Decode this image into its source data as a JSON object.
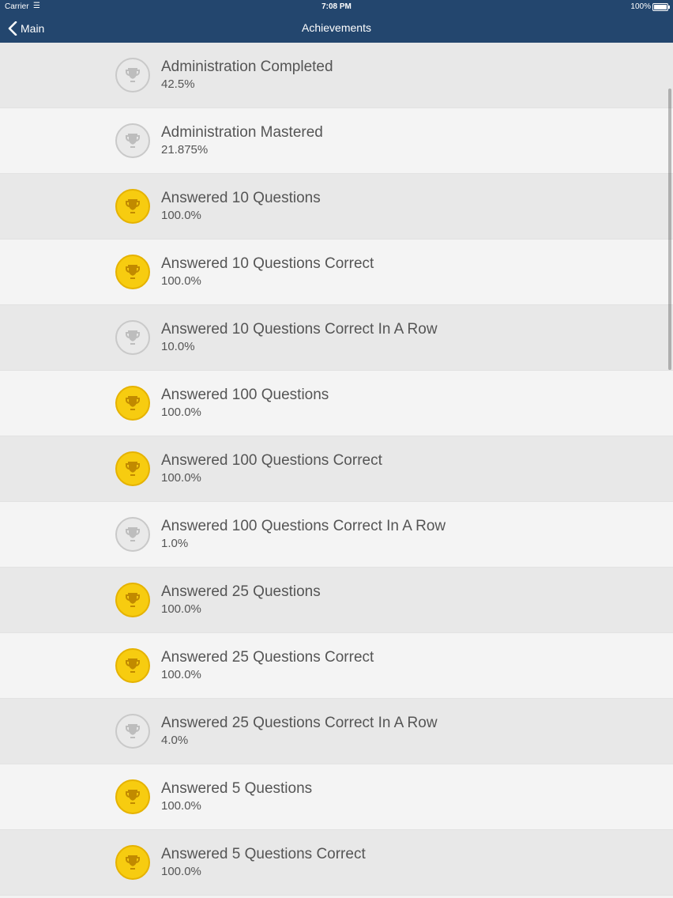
{
  "status_bar": {
    "carrier": "Carrier",
    "time": "7:08 PM",
    "battery": "100%"
  },
  "nav": {
    "back_label": "Main",
    "title": "Achievements"
  },
  "colors": {
    "nav_bar": "#23466e",
    "unlocked": "#f7cc10",
    "locked": "#e9e9e9"
  },
  "achievements": [
    {
      "name": "Administration Completed",
      "percent": "42.5%",
      "unlocked": false
    },
    {
      "name": "Administration Mastered",
      "percent": "21.875%",
      "unlocked": false
    },
    {
      "name": "Answered 10 Questions",
      "percent": "100.0%",
      "unlocked": true
    },
    {
      "name": "Answered 10 Questions Correct",
      "percent": "100.0%",
      "unlocked": true
    },
    {
      "name": "Answered 10 Questions Correct In A Row",
      "percent": "10.0%",
      "unlocked": false
    },
    {
      "name": "Answered 100 Questions",
      "percent": "100.0%",
      "unlocked": true
    },
    {
      "name": "Answered 100 Questions Correct",
      "percent": "100.0%",
      "unlocked": true
    },
    {
      "name": "Answered 100 Questions Correct In A Row",
      "percent": "1.0%",
      "unlocked": false
    },
    {
      "name": "Answered 25 Questions",
      "percent": "100.0%",
      "unlocked": true
    },
    {
      "name": "Answered 25 Questions Correct",
      "percent": "100.0%",
      "unlocked": true
    },
    {
      "name": "Answered 25 Questions Correct In A Row",
      "percent": "4.0%",
      "unlocked": false
    },
    {
      "name": "Answered 5 Questions",
      "percent": "100.0%",
      "unlocked": true
    },
    {
      "name": "Answered 5 Questions Correct",
      "percent": "100.0%",
      "unlocked": true
    }
  ]
}
